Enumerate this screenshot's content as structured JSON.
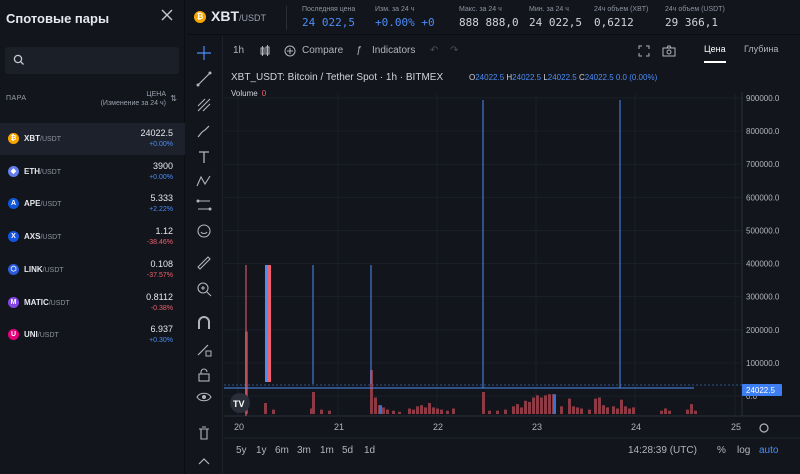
{
  "sidebar": {
    "title": "Спотовые пары",
    "header_pair": "ПАРА",
    "header_price": "ЦЕНА",
    "header_change": "(Изменение за 24 ч)",
    "pairs": [
      {
        "base": "XBT",
        "quote": "/USDT",
        "price": "24022.5",
        "change": "+0.00%",
        "color": "#f7a600",
        "glyph": "₿",
        "dir": "pos"
      },
      {
        "base": "ETH",
        "quote": "/USDT",
        "price": "3900",
        "change": "+0.00%",
        "color": "#627eea",
        "glyph": "◆",
        "dir": "pos"
      },
      {
        "base": "APE",
        "quote": "/USDT",
        "price": "5.333",
        "change": "+2.22%",
        "color": "#0f56d8",
        "glyph": "A",
        "dir": "pos"
      },
      {
        "base": "AXS",
        "quote": "/USDT",
        "price": "1.12",
        "change": "-38.46%",
        "color": "#1754e0",
        "glyph": "X",
        "dir": "neg"
      },
      {
        "base": "LINK",
        "quote": "/USDT",
        "price": "0.108",
        "change": "-37.57%",
        "color": "#2a5ada",
        "glyph": "⬡",
        "dir": "neg"
      },
      {
        "base": "MATIC",
        "quote": "/USDT",
        "price": "0.8112",
        "change": "-0.38%",
        "color": "#8247e5",
        "glyph": "M",
        "dir": "neg"
      },
      {
        "base": "UNI",
        "quote": "/USDT",
        "price": "6.937",
        "change": "+0.30%",
        "color": "#e6007a",
        "glyph": "U",
        "dir": "pos"
      }
    ]
  },
  "topbar": {
    "symbol": "XBT",
    "quote": "/USDT",
    "stats": [
      {
        "label": "Последняя цена",
        "value": "24 022,5",
        "blue": true
      },
      {
        "label": "Изм. за 24 ч",
        "value": "+0.00% +0",
        "blue": true
      },
      {
        "label": "Макс. за 24 ч",
        "value": "888 888,0",
        "blue": false
      },
      {
        "label": "Мин. за 24 ч",
        "value": "24 022,5",
        "blue": false
      },
      {
        "label": "24ч объем (XBT)",
        "value": "0,6212",
        "blue": false
      },
      {
        "label": "24ч объем (USDT)",
        "value": "29 366,1",
        "blue": false
      }
    ]
  },
  "chart_header": {
    "interval": "1h",
    "compare": "Compare",
    "indicators": "Indicators",
    "tab_price": "Цена",
    "tab_depth": "Глубина"
  },
  "legend": {
    "title": "XBT_USDT: Bitcoin / Tether Spot · 1h · BITMEX",
    "o_label": "O",
    "o": "24022.5",
    "h_label": "H",
    "h": "24022.5",
    "l_label": "L",
    "l": "24022.5",
    "c_label": "C",
    "c": "24022.5",
    "change": "0.0 (0.00%)",
    "volume_label": "Volume",
    "volume_value": "0"
  },
  "timeframes": [
    "5y",
    "1y",
    "6m",
    "3m",
    "1m",
    "5d",
    "1d"
  ],
  "footer": {
    "time": "14:28:39 (UTC)",
    "pct": "%",
    "log": "log",
    "auto": "auto"
  },
  "chart_data": {
    "type": "bar",
    "price_axis": [
      "900000.0",
      "800000.0",
      "700000.0",
      "600000.0",
      "500000.0",
      "400000.0",
      "300000.0",
      "200000.0",
      "100000.0",
      "0.0"
    ],
    "time_axis": [
      "20",
      "21",
      "22",
      "23",
      "24",
      "25"
    ],
    "last_price": "24022.5",
    "ylim": [
      0,
      900000
    ],
    "colors": {
      "up": "#4c8df6",
      "down": "#f0616d",
      "volume": "#8c3a44"
    }
  }
}
